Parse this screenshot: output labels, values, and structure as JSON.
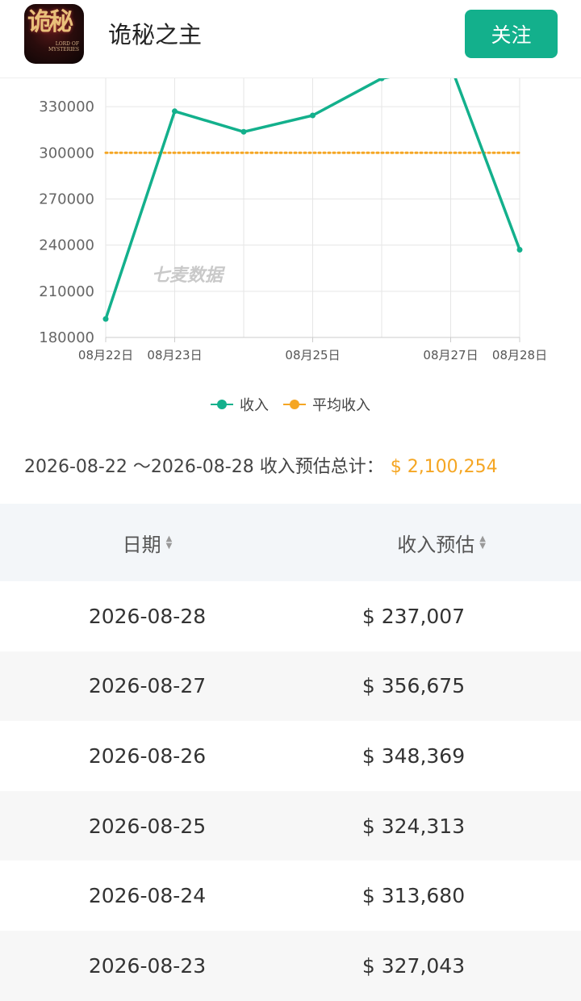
{
  "header": {
    "app_icon": {
      "glyphs": "诡秘",
      "small_text": "LORD OF MYSTERIES"
    },
    "title": "诡秘之主",
    "follow_label": "关注"
  },
  "chart_data": {
    "type": "line",
    "x": [
      "08月22日",
      "08月23日",
      "08月24日",
      "08月25日",
      "08月26日",
      "08月27日",
      "08月28日"
    ],
    "x_tick_labels": [
      "08月22日",
      "08月23日",
      "08月25日",
      "08月27日",
      "08月28日"
    ],
    "series": [
      {
        "name": "收入",
        "values": [
          192000,
          327043,
          313680,
          324313,
          348369,
          356675,
          237007
        ],
        "color": "#13b08c"
      },
      {
        "name": "平均收入",
        "values": [
          300036,
          300036,
          300036,
          300036,
          300036,
          300036,
          300036
        ],
        "color": "#f5a623"
      }
    ],
    "y_ticks": [
      180000,
      210000,
      240000,
      270000,
      300000,
      330000
    ],
    "ylim": [
      180000,
      360000
    ],
    "watermark": "七麦数据",
    "grid": true,
    "legend_position": "bottom"
  },
  "legend": [
    {
      "label": "收入",
      "color": "#13b08c"
    },
    {
      "label": "平均收入",
      "color": "#f5a623"
    }
  ],
  "summary": {
    "range": "2026-08-22 ～2026-08-28 收入预估总计：",
    "total": "$ 2,100,254"
  },
  "table": {
    "headers": {
      "date": "日期",
      "revenue": "收入预估"
    },
    "rows": [
      {
        "date": "2026-08-28",
        "revenue": "$ 237,007"
      },
      {
        "date": "2026-08-27",
        "revenue": "$ 356,675"
      },
      {
        "date": "2026-08-26",
        "revenue": "$ 348,369"
      },
      {
        "date": "2026-08-25",
        "revenue": "$ 324,313"
      },
      {
        "date": "2026-08-24",
        "revenue": "$ 313,680"
      },
      {
        "date": "2026-08-23",
        "revenue": "$ 327,043"
      }
    ]
  }
}
